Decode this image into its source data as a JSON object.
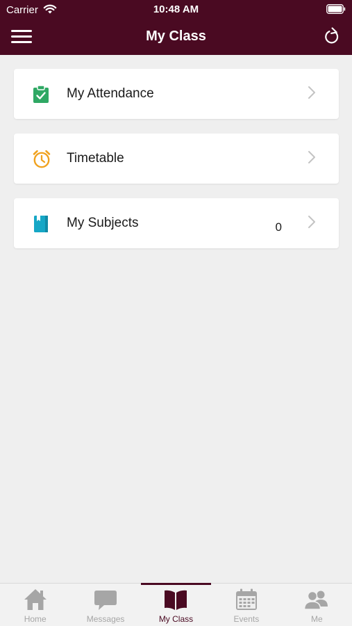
{
  "status_bar": {
    "carrier": "Carrier",
    "time": "10:48 AM"
  },
  "header": {
    "title": "My Class",
    "menu_icon": "hamburger-menu-icon",
    "refresh_icon": "refresh-icon"
  },
  "items": [
    {
      "label": "My Attendance",
      "icon": "clipboard-check-icon",
      "count": ""
    },
    {
      "label": "Timetable",
      "icon": "alarm-clock-icon",
      "count": ""
    },
    {
      "label": "My Subjects",
      "icon": "book-icon",
      "count": "0"
    }
  ],
  "tabs": [
    {
      "label": "Home",
      "icon": "home-icon"
    },
    {
      "label": "Messages",
      "icon": "chat-bubble-icon"
    },
    {
      "label": "My Class",
      "icon": "open-book-icon",
      "active": true
    },
    {
      "label": "Events",
      "icon": "calendar-icon"
    },
    {
      "label": "Me",
      "icon": "people-icon"
    }
  ],
  "colors": {
    "primary": "#4a0a22",
    "attendance_icon": "#2fa864",
    "timetable_icon": "#f0a21f",
    "subjects_icon": "#16a7c6",
    "inactive_tab": "#a6a6a6"
  }
}
